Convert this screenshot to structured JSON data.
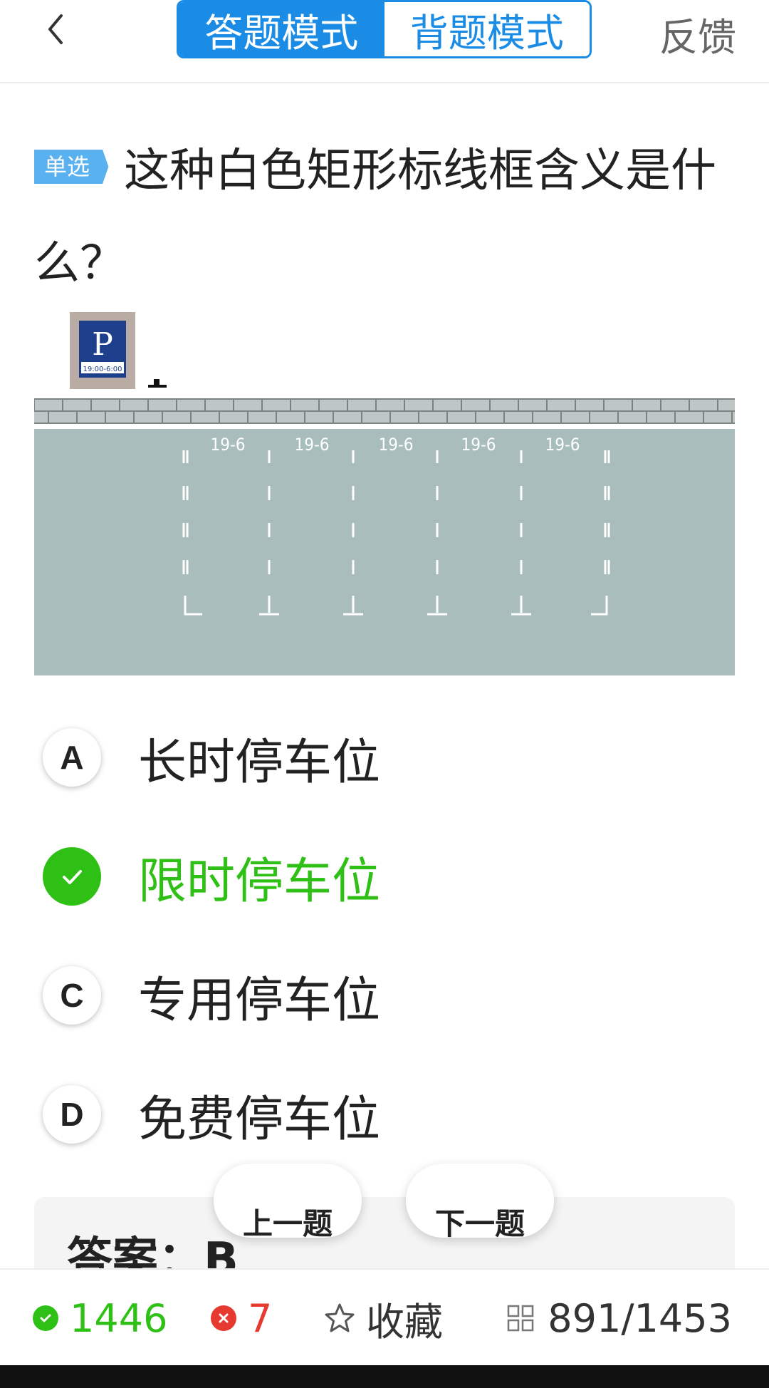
{
  "header": {
    "back_icon": "chevron-left-icon",
    "mode_active": "答题模式",
    "mode_inactive": "背题模式",
    "feedback": "反馈",
    "accent_color": "#1a8ce6"
  },
  "question": {
    "type_tag": "单选",
    "text": "这种白色矩形标线框含义是什么？"
  },
  "illustration": {
    "sign_letter": "P",
    "sign_time": "19:00-6:00",
    "slot_labels": [
      "19-6",
      "19-6",
      "19-6",
      "19-6",
      "19-6"
    ]
  },
  "options": [
    {
      "key": "A",
      "text": "长时停车位",
      "state": "normal"
    },
    {
      "key": "B",
      "text": "限时停车位",
      "state": "correct"
    },
    {
      "key": "C",
      "text": "专用停车位",
      "state": "normal"
    },
    {
      "key": "D",
      "text": "免费停车位",
      "state": "normal"
    }
  ],
  "navigation": {
    "prev_label": "上一题",
    "next_label": "下一题"
  },
  "answer": {
    "text": "答案：B"
  },
  "footer": {
    "correct_count": "1446",
    "wrong_count": "7",
    "favorite_label": "收藏",
    "progress": "891/1453",
    "correct_color": "#2ec014",
    "wrong_color": "#e6392f"
  }
}
